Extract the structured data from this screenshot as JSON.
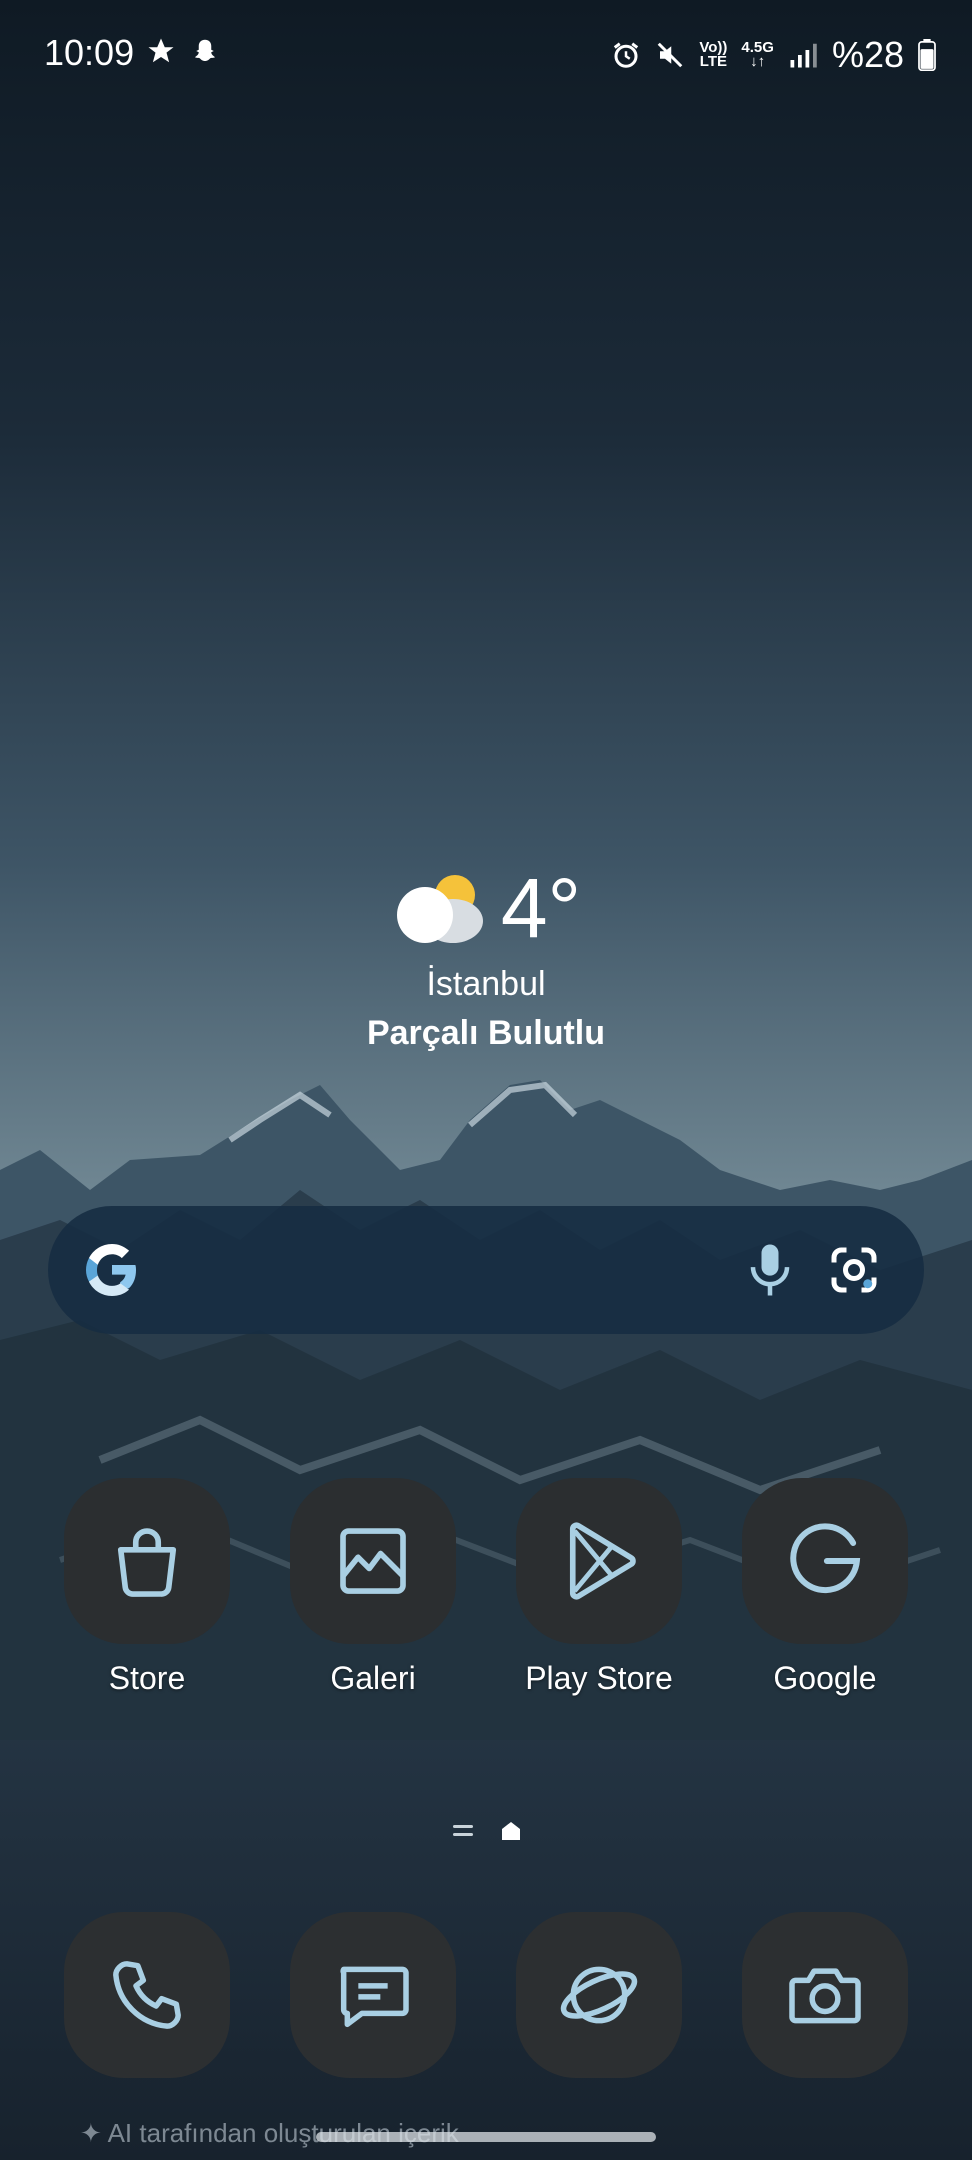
{
  "status_bar": {
    "time": "10:09",
    "left_icons": [
      "star-icon",
      "snapchat-icon"
    ],
    "right_icons": [
      "alarm-icon",
      "mute-icon",
      "volte-icon",
      "data-4-5g-icon",
      "signal-icon",
      "battery-icon"
    ],
    "volte_line1": "Vo))",
    "volte_line2": "LTE",
    "network_label": "4.5G",
    "battery": "%28"
  },
  "weather": {
    "icon": "partly-cloudy-icon",
    "temperature": "4°",
    "city": "İstanbul",
    "condition": "Parçalı Bulutlu"
  },
  "search": {
    "logo": "google-logo-icon",
    "mic": "mic-icon",
    "lens": "lens-icon"
  },
  "apps": [
    {
      "label": "Store",
      "icon": "shopping-bag-icon"
    },
    {
      "label": "Galeri",
      "icon": "gallery-icon"
    },
    {
      "label": "Play Store",
      "icon": "play-store-icon"
    },
    {
      "label": "Google",
      "icon": "google-g-icon"
    }
  ],
  "page_indicator": {
    "items": [
      "list-page-icon",
      "home-page-icon"
    ],
    "active": "home-page-icon"
  },
  "dock": [
    {
      "icon": "phone-icon"
    },
    {
      "icon": "messages-icon"
    },
    {
      "icon": "internet-icon"
    },
    {
      "icon": "camera-icon"
    }
  ],
  "footer": {
    "ai_note": "AI tarafından oluşturulan içerik"
  },
  "colors": {
    "icon_accent": "#a9cfe3",
    "app_icon_bg": "#2b2e30",
    "search_bg": "#162c42"
  }
}
